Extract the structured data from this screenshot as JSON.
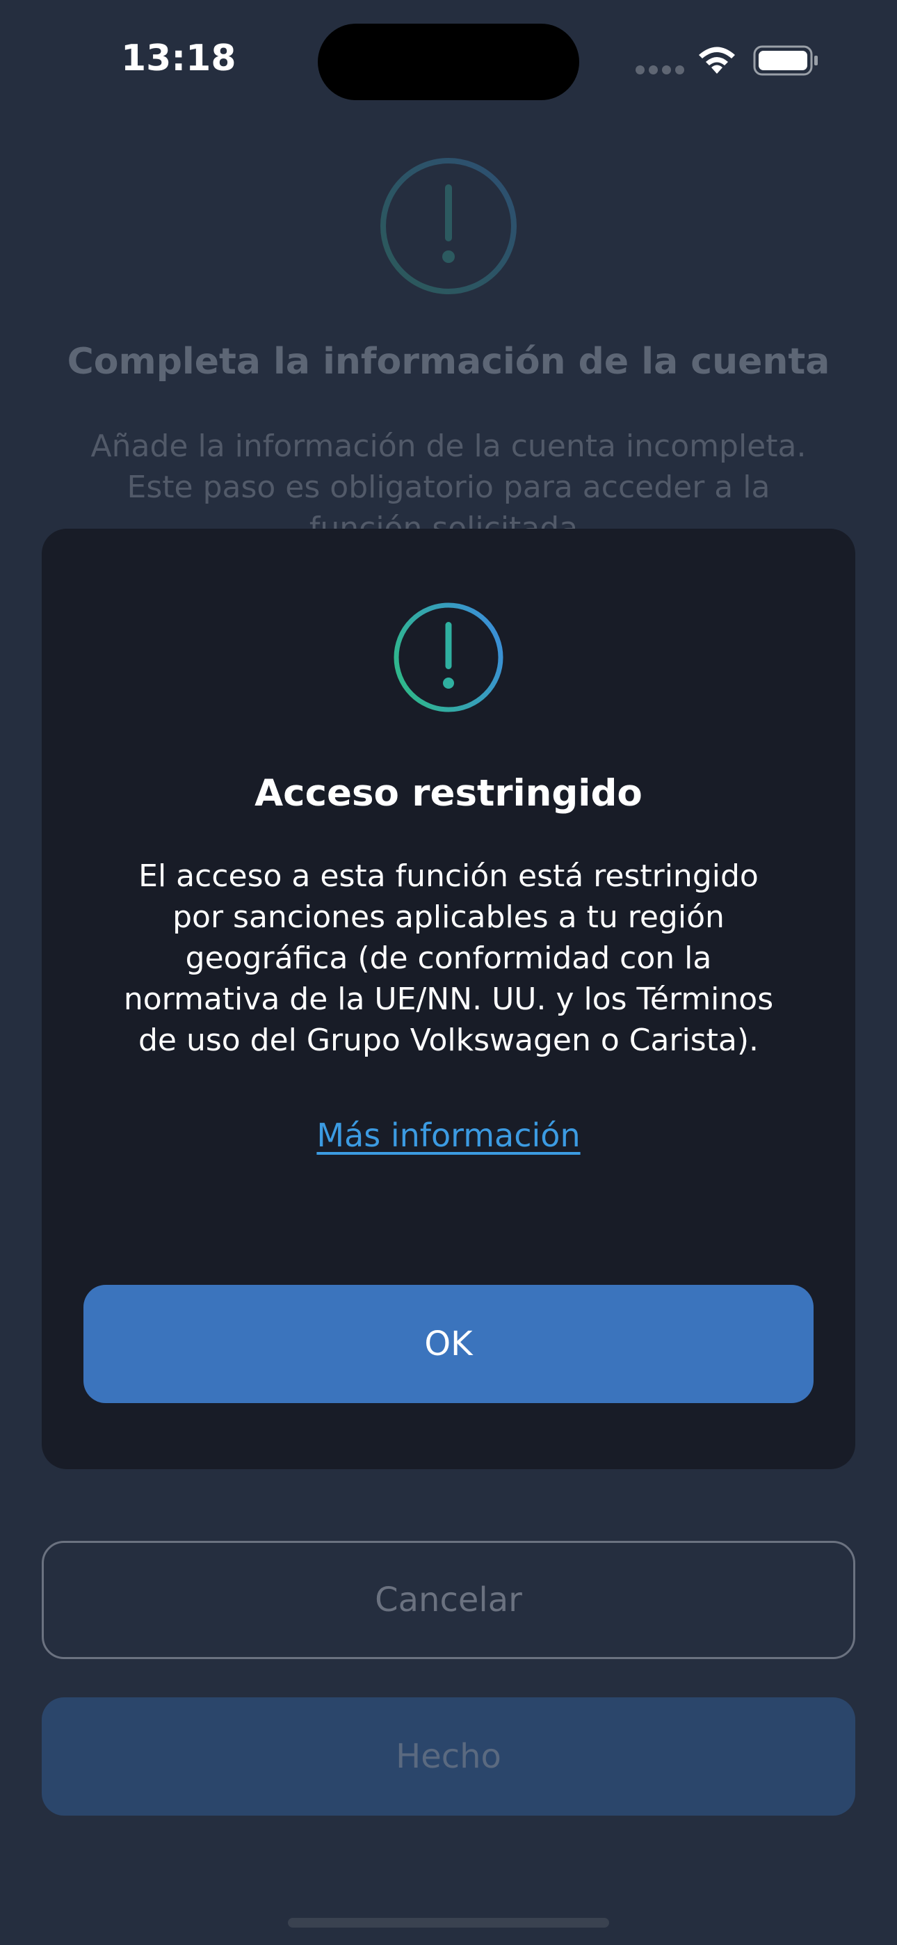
{
  "status_bar": {
    "time": "13:18"
  },
  "background": {
    "icon": "alert-circle-icon",
    "title": "Completa la información de la cuenta",
    "subtitle_lines": [
      "Añade la información de la cuenta incompleta.",
      "Este paso es obligatorio para acceder a la",
      "función solicitada."
    ]
  },
  "modal": {
    "icon": "alert-circle-icon",
    "title": "Acceso restringido",
    "body_lines": [
      "El acceso a esta función está restringido",
      "por sanciones aplicables a tu región",
      "geográfica (de conformidad con la",
      "normativa de la UE/NN. UU. y los Términos",
      "de uso del Grupo Volkswagen o Carista)."
    ],
    "link_label": "Más información",
    "ok_label": "OK"
  },
  "actions": {
    "cancel_label": "Cancelar",
    "done_label": "Hecho"
  },
  "colors": {
    "background": "#252e3f",
    "modal": "#181c27",
    "primary_button": "#3b74bd",
    "link": "#3c9be2",
    "icon_gradient_start": "#2fb88a",
    "icon_gradient_end": "#3b8fd8",
    "disabled_button": "#2b466b"
  }
}
